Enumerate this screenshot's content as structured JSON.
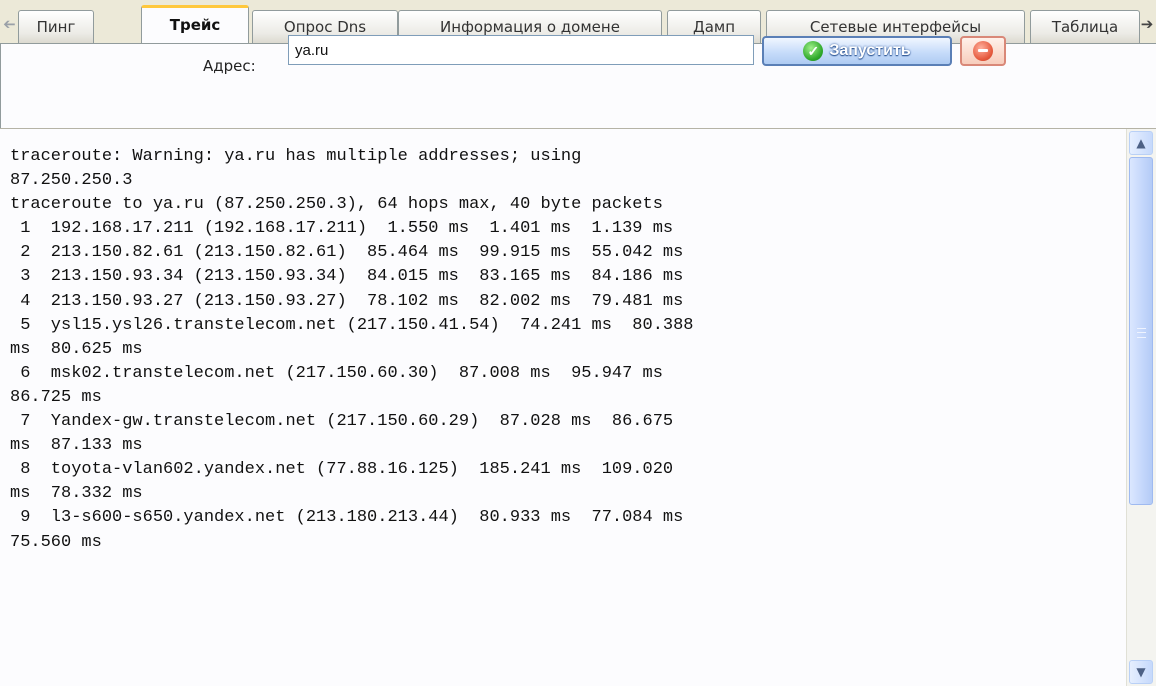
{
  "tabs": {
    "scroll_left_icon": "arrow-left-icon",
    "scroll_right_icon": "arrow-right-icon",
    "items": [
      {
        "label": "Пинг"
      },
      {
        "label": "Трейс",
        "active": true
      },
      {
        "label": "Опрос Dns"
      },
      {
        "label": "Информация о домене"
      },
      {
        "label": "Дамп"
      },
      {
        "label": "Сетевые интерфейсы"
      },
      {
        "label": "Таблица"
      }
    ]
  },
  "form": {
    "address_label": "Адрес:",
    "address_value": "ya.ru",
    "run_label": "Запустить",
    "run_icon": "check-circle-icon",
    "stop_icon": "stop-icon"
  },
  "output": {
    "lines": [
      "traceroute: Warning: ya.ru has multiple addresses; using",
      "87.250.250.3",
      "traceroute to ya.ru (87.250.250.3), 64 hops max, 40 byte packets",
      " 1  192.168.17.211 (192.168.17.211)  1.550 ms  1.401 ms  1.139 ms",
      " 2  213.150.82.61 (213.150.82.61)  85.464 ms  99.915 ms  55.042 ms",
      " 3  213.150.93.34 (213.150.93.34)  84.015 ms  83.165 ms  84.186 ms",
      " 4  213.150.93.27 (213.150.93.27)  78.102 ms  82.002 ms  79.481 ms",
      " 5  ysl15.ysl26.transtelecom.net (217.150.41.54)  74.241 ms  80.388",
      "ms  80.625 ms",
      " 6  msk02.transtelecom.net (217.150.60.30)  87.008 ms  95.947 ms",
      "86.725 ms",
      " 7  Yandex-gw.transtelecom.net (217.150.60.29)  87.028 ms  86.675",
      "ms  87.133 ms",
      " 8  toyota-vlan602.yandex.net (77.88.16.125)  185.241 ms  109.020",
      "ms  78.332 ms",
      " 9  l3-s600-s650.yandex.net (213.180.213.44)  80.933 ms  77.084 ms",
      "75.560 ms"
    ]
  },
  "scrollbar": {
    "up_icon": "chevron-up-icon",
    "down_icon": "chevron-down-icon"
  },
  "colors": {
    "active_tab_accent": "#ffc83c",
    "run_button": "#aecbf2",
    "stop_button": "#e5593d"
  }
}
